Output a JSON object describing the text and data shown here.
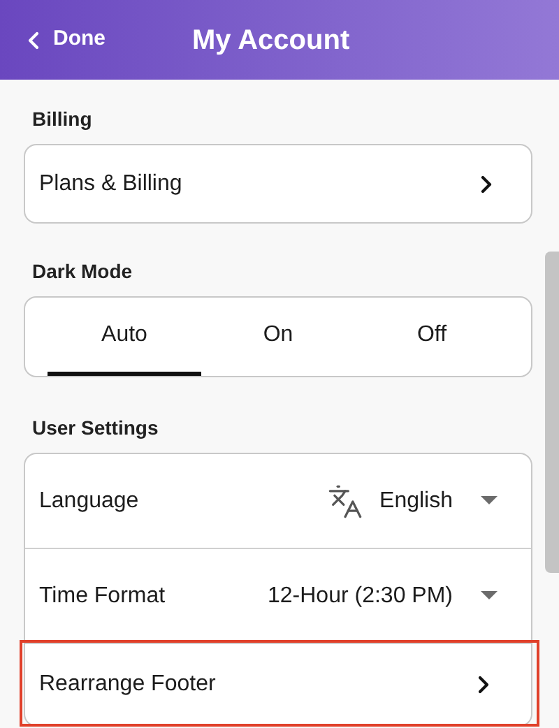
{
  "header": {
    "back": "Done",
    "title": "My Account"
  },
  "billing": {
    "label": "Billing",
    "row": "Plans & Billing"
  },
  "dark_mode": {
    "label": "Dark Mode",
    "tabs": [
      {
        "label": "Auto",
        "selected": true
      },
      {
        "label": "On",
        "selected": false
      },
      {
        "label": "Off",
        "selected": false
      }
    ]
  },
  "user_settings": {
    "label": "User Settings",
    "rows": [
      {
        "kind": "select",
        "label": "Language",
        "value": "English",
        "icon": true,
        "highlighted": false
      },
      {
        "kind": "select",
        "label": "Time Format",
        "value": "12-Hour (2:30 PM)",
        "icon": false,
        "highlighted": false
      },
      {
        "kind": "link",
        "label": "Rearrange Footer",
        "highlighted": true
      }
    ]
  }
}
